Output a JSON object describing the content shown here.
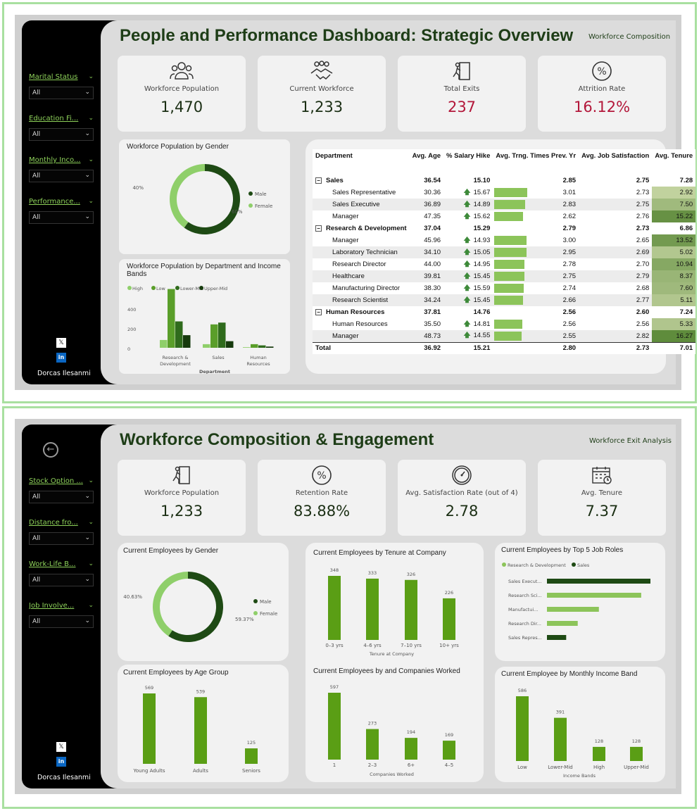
{
  "colors": {
    "dark_green": "#1e4a14",
    "mid_green": "#5a9e2a",
    "light_green": "#8fcf6a",
    "bar_green": "#5a9e15",
    "red": "#b3173a"
  },
  "page1": {
    "title": "People and Performance Dashboard: Strategic Overview",
    "nav_link": "Workforce Composition",
    "slicers": [
      {
        "label": "Marital Status",
        "value": "All"
      },
      {
        "label": "Education Fi...",
        "value": "All"
      },
      {
        "label": "Monthly Inco...",
        "value": "All"
      },
      {
        "label": "Performance...",
        "value": "All"
      }
    ],
    "social": {
      "x": "𝕏",
      "linkedin": "in"
    },
    "author": "Dorcas Ilesanmi",
    "kpis": [
      {
        "icon": "people-group-icon",
        "label": "Workforce Population",
        "value": "1,470"
      },
      {
        "icon": "handshake-icon",
        "label": "Current Workforce",
        "value": "1,233"
      },
      {
        "icon": "exit-door-icon",
        "label": "Total Exits",
        "value": "237"
      },
      {
        "icon": "percent-icon",
        "label": "Attrition Rate",
        "value": "16.12%"
      }
    ],
    "gender_chart": {
      "title": "Workforce Population by Gender",
      "chart_data": {
        "type": "pie",
        "categories": [
          "Male",
          "Female"
        ],
        "values": [
          60,
          40
        ],
        "labels": [
          "60%",
          "40%"
        ],
        "legend": [
          "Male",
          "Female"
        ],
        "colors": [
          "#1e4a14",
          "#8fcf6a"
        ]
      }
    },
    "dept_income_chart": {
      "title": "Workforce Population by Department and Income Bands",
      "chart_data": {
        "type": "bar",
        "categories": [
          "Research & Development",
          "Sales",
          "Human Resources"
        ],
        "xlabel": "Department",
        "ylim": [
          0,
          500
        ],
        "yticks": [
          "400",
          "200",
          "0"
        ],
        "series": [
          {
            "name": "High",
            "values": [
              65,
              30,
              5
            ],
            "color": "#8fcf6a"
          },
          {
            "name": "Low",
            "values": [
              490,
              195,
              30
            ],
            "color": "#5a9e2a"
          },
          {
            "name": "Lower-Mid",
            "values": [
              220,
              210,
              20
            ],
            "color": "#2f6b1c"
          },
          {
            "name": "Upper-Mid",
            "values": [
              105,
              55,
              10
            ],
            "color": "#163a0d"
          }
        ]
      }
    },
    "matrix": {
      "headers": [
        "Department",
        "Avg. Age",
        "% Salary Hike",
        "Avg. Trng. Times Prev. Yr",
        "Avg. Job Satisfaction",
        "Avg. Tenure"
      ],
      "rows": [
        {
          "type": "group",
          "dept": "Sales",
          "age": "36.54",
          "hike": "15.10",
          "trng": "2.85",
          "sat": "2.75",
          "tenure": "7.28"
        },
        {
          "type": "item",
          "dept": "Sales Representative",
          "age": "30.36",
          "hike": "15.67",
          "trng": "3.01",
          "sat": "2.73",
          "tenure": "2.92",
          "trng_v": 3.01,
          "ten_v": 2.92
        },
        {
          "type": "item",
          "dept": "Sales Executive",
          "age": "36.89",
          "hike": "14.89",
          "trng": "2.83",
          "sat": "2.75",
          "tenure": "7.50",
          "trng_v": 2.83,
          "ten_v": 7.5
        },
        {
          "type": "item",
          "dept": "Manager",
          "age": "47.35",
          "hike": "15.62",
          "trng": "2.62",
          "sat": "2.76",
          "tenure": "15.22",
          "trng_v": 2.62,
          "ten_v": 15.22
        },
        {
          "type": "group",
          "dept": "Research & Development",
          "age": "37.04",
          "hike": "15.29",
          "trng": "2.79",
          "sat": "2.73",
          "tenure": "6.86"
        },
        {
          "type": "item",
          "dept": "Manager",
          "age": "45.96",
          "hike": "14.93",
          "trng": "3.00",
          "sat": "2.65",
          "tenure": "13.52",
          "trng_v": 3.0,
          "ten_v": 13.52
        },
        {
          "type": "item",
          "dept": "Laboratory Technician",
          "age": "34.10",
          "hike": "15.05",
          "trng": "2.95",
          "sat": "2.69",
          "tenure": "5.02",
          "trng_v": 2.95,
          "ten_v": 5.02
        },
        {
          "type": "item",
          "dept": "Research Director",
          "age": "44.00",
          "hike": "14.95",
          "trng": "2.78",
          "sat": "2.70",
          "tenure": "10.94",
          "trng_v": 2.78,
          "ten_v": 10.94
        },
        {
          "type": "item",
          "dept": "Healthcare",
          "age": "39.81",
          "hike": "15.45",
          "trng": "2.75",
          "sat": "2.79",
          "tenure": "8.37",
          "trng_v": 2.75,
          "ten_v": 8.37
        },
        {
          "type": "item",
          "dept": "Manufacturing Director",
          "age": "38.30",
          "hike": "15.59",
          "trng": "2.74",
          "sat": "2.68",
          "tenure": "7.60",
          "trng_v": 2.74,
          "ten_v": 7.6
        },
        {
          "type": "item",
          "dept": "Research Scientist",
          "age": "34.24",
          "hike": "15.45",
          "trng": "2.66",
          "sat": "2.77",
          "tenure": "5.11",
          "trng_v": 2.66,
          "ten_v": 5.11
        },
        {
          "type": "group",
          "dept": "Human Resources",
          "age": "37.81",
          "hike": "14.76",
          "trng": "2.56",
          "sat": "2.60",
          "tenure": "7.24"
        },
        {
          "type": "item",
          "dept": "Human Resources",
          "age": "35.50",
          "hike": "14.81",
          "trng": "2.56",
          "sat": "2.56",
          "tenure": "5.33",
          "trng_v": 2.56,
          "ten_v": 5.33
        },
        {
          "type": "item",
          "dept": "Manager",
          "age": "48.73",
          "hike": "14.55",
          "trng": "2.55",
          "sat": "2.82",
          "tenure": "16.27",
          "trng_v": 2.55,
          "ten_v": 16.27
        },
        {
          "type": "total",
          "dept": "Total",
          "age": "36.92",
          "hike": "15.21",
          "trng": "2.80",
          "sat": "2.73",
          "tenure": "7.01"
        }
      ]
    }
  },
  "page2": {
    "title": "Workforce Composition & Engagement",
    "nav_link": "Workforce Exit Analysis",
    "back_icon": "←",
    "slicers": [
      {
        "label": "Stock Option ...",
        "value": "All"
      },
      {
        "label": "Distance fro...",
        "value": "All"
      },
      {
        "label": "Work-Life B...",
        "value": "All"
      },
      {
        "label": "Job Involve...",
        "value": "All"
      }
    ],
    "social": {
      "x": "𝕏",
      "linkedin": "in"
    },
    "author": "Dorcas Ilesanmi",
    "kpis": [
      {
        "icon": "exit-door-icon",
        "label": "Workforce Population",
        "value": "1,233"
      },
      {
        "icon": "percent-icon",
        "label": "Retention Rate",
        "value": "83.88%"
      },
      {
        "icon": "gauge-icon",
        "label": "Avg. Satisfaction Rate (out of 4)",
        "value": "2.78"
      },
      {
        "icon": "calendar-icon",
        "label": "Avg. Tenure",
        "value": "7.37"
      }
    ],
    "gender_chart": {
      "title": "Current Employees by Gender",
      "chart_data": {
        "type": "pie",
        "categories": [
          "Male",
          "Female"
        ],
        "values": [
          59.37,
          40.63
        ],
        "labels": [
          "59.37%",
          "40.63%"
        ],
        "legend": [
          "Male",
          "Female"
        ],
        "colors": [
          "#1e4a14",
          "#8fcf6a"
        ]
      }
    },
    "age_chart": {
      "title": "Current Employees by Age Group",
      "chart_data": {
        "type": "bar",
        "categories": [
          "Young Adults",
          "Adults",
          "Seniors"
        ],
        "values": [
          569,
          539,
          125
        ],
        "labels": [
          "569",
          "539",
          "125"
        ]
      }
    },
    "tenure_chart": {
      "title": "Current Employees by Tenure at Company",
      "chart_data": {
        "type": "bar",
        "categories": [
          "0–3 yrs",
          "4–6 yrs",
          "7–10 yrs",
          "10+ yrs"
        ],
        "values": [
          348,
          333,
          326,
          226
        ],
        "labels": [
          "348",
          "333",
          "326",
          "226"
        ],
        "xlabel": "Tenure at Company"
      }
    },
    "companies_chart": {
      "title": "Current Employees by and Companies Worked",
      "chart_data": {
        "type": "bar",
        "categories": [
          "1",
          "2–3",
          "6+",
          "4–5"
        ],
        "values": [
          597,
          273,
          194,
          169
        ],
        "labels": [
          "597",
          "273",
          "194",
          "169"
        ],
        "xlabel": "Companies Worked"
      }
    },
    "roles_chart": {
      "title": "Current Employees by Top 5 Job Roles",
      "chart_data": {
        "type": "bar",
        "orientation": "horizontal",
        "categories": [
          "Sales Execut...",
          "Research Sci...",
          "Manufactui...",
          "Research Dir...",
          "Sales Repres..."
        ],
        "values": [
          269,
          245,
          135,
          80,
          50
        ],
        "series_of": [
          "Sales",
          "Research & Development",
          "Research & Development",
          "Research & Development",
          "Sales"
        ],
        "legend": [
          "Research & Development",
          "Sales"
        ]
      }
    },
    "income_chart": {
      "title": "Current Employee by Monthly Income Band",
      "chart_data": {
        "type": "bar",
        "categories": [
          "Low",
          "Lower-Mid",
          "High",
          "Upper-Mid"
        ],
        "values": [
          586,
          391,
          128,
          128
        ],
        "labels": [
          "586",
          "391",
          "128",
          "128"
        ],
        "xlabel": "Income Bands"
      }
    }
  }
}
